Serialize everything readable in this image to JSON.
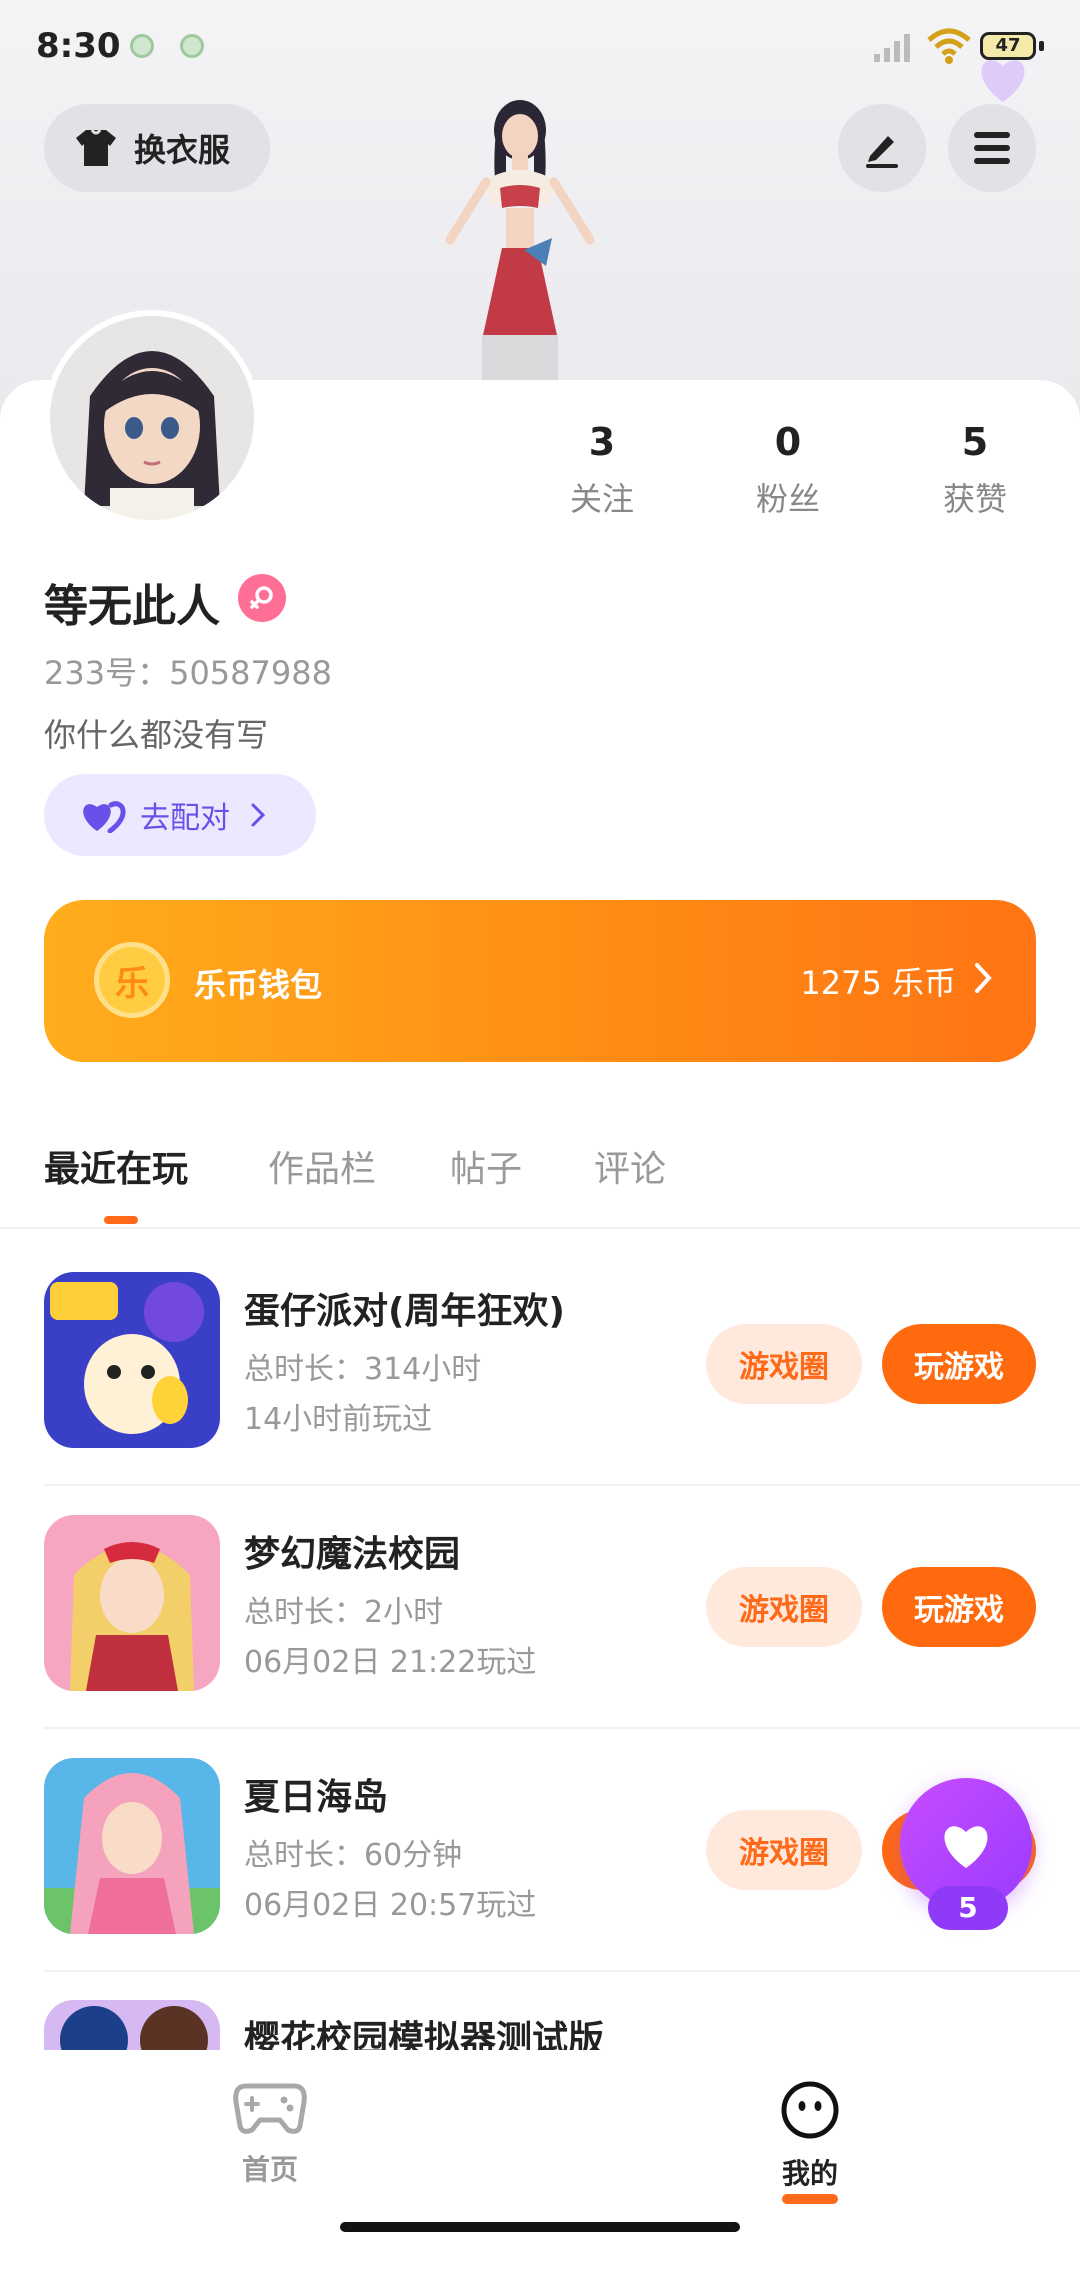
{
  "status_bar": {
    "time": "8:30",
    "battery": "47"
  },
  "header": {
    "outfit_label": "换衣服"
  },
  "profile": {
    "stats": [
      {
        "num": "3",
        "label": "关注"
      },
      {
        "num": "0",
        "label": "粉丝"
      },
      {
        "num": "5",
        "label": "获赞"
      }
    ],
    "nickname": "等无此人",
    "uid": "233号：50587988",
    "bio": "你什么都没有写",
    "match_label": "去配对"
  },
  "wallet": {
    "coin_glyph": "乐",
    "title": "乐币钱包",
    "amount": "1275 乐币"
  },
  "tabs": [
    "最近在玩",
    "作品栏",
    "帖子",
    "评论"
  ],
  "games": [
    {
      "name": "蛋仔派对(周年狂欢)",
      "duration": "总时长：314小时",
      "last": "14小时前玩过",
      "circle": "游戏圈",
      "play": "玩游戏"
    },
    {
      "name": "梦幻魔法校园",
      "duration": "总时长：2小时",
      "last": "06月02日 21:22玩过",
      "circle": "游戏圈",
      "play": "玩游戏"
    },
    {
      "name": "夏日海岛",
      "duration": "总时长：60分钟",
      "last": "06月02日 20:57玩过",
      "circle": "游戏圈",
      "play": "玩游戏"
    },
    {
      "name": "樱花校园模拟器测试版",
      "duration": "",
      "last": "",
      "circle": "",
      "play": ""
    }
  ],
  "floating_heart": {
    "count": "5"
  },
  "bottom_nav": {
    "home": "首页",
    "mine": "我的"
  },
  "colors": {
    "accent": "#ff6a0f",
    "wallet_start": "#ffad1d",
    "wallet_end": "#ff7414",
    "heart": "#b447ff"
  }
}
